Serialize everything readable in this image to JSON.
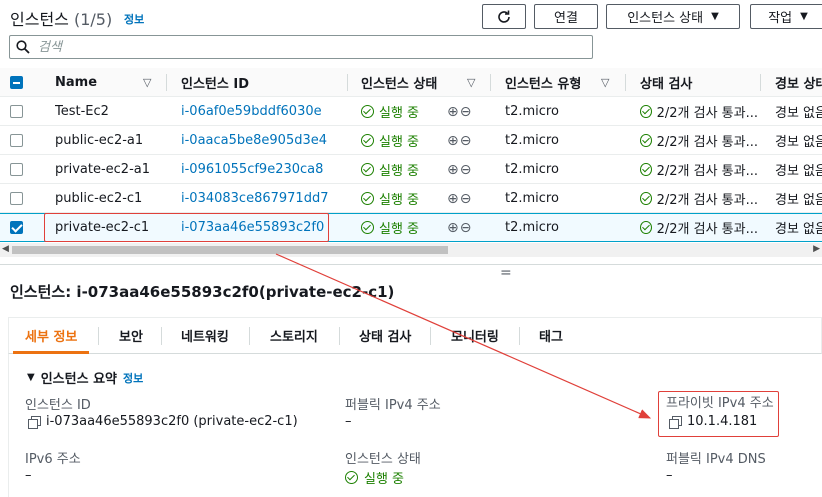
{
  "header": {
    "title": "인스턴스",
    "count": "(1/5)",
    "info": "정보",
    "refresh_icon": "refresh-icon",
    "connect_label": "연결",
    "state_label": "인스턴스 상태",
    "actions_label": "작업"
  },
  "search": {
    "placeholder": "검색"
  },
  "table": {
    "columns": [
      "Name",
      "인스턴스 ID",
      "인스턴스 상태",
      "인스턴스 유형",
      "상태 검사",
      "경보 상태"
    ],
    "rows": [
      {
        "name": "Test-Ec2",
        "id": "i-06af0e59bddf6030e",
        "state": "실행 중",
        "type": "t2.micro",
        "check": "2/2개 검사 통과...",
        "alarm": "경보 없음",
        "selected": false
      },
      {
        "name": "public-ec2-a1",
        "id": "i-0aaca5be8e905d3e4",
        "state": "실행 중",
        "type": "t2.micro",
        "check": "2/2개 검사 통과...",
        "alarm": "경보 없음",
        "selected": false
      },
      {
        "name": "private-ec2-a1",
        "id": "i-0961055cf9e230ca8",
        "state": "실행 중",
        "type": "t2.micro",
        "check": "2/2개 검사 통과...",
        "alarm": "경보 없음",
        "selected": false
      },
      {
        "name": "public-ec2-c1",
        "id": "i-034083ce867971dd7",
        "state": "실행 중",
        "type": "t2.micro",
        "check": "2/2개 검사 통과...",
        "alarm": "경보 없음",
        "selected": false
      },
      {
        "name": "private-ec2-c1",
        "id": "i-073aa46e55893c2f0",
        "state": "실행 중",
        "type": "t2.micro",
        "check": "2/2개 검사 통과...",
        "alarm": "경보 없음",
        "selected": true
      }
    ]
  },
  "detail": {
    "title": "인스턴스: i-073aa46e55893c2f0(private-ec2-c1)",
    "tabs": [
      "세부 정보",
      "보안",
      "네트워킹",
      "스토리지",
      "상태 검사",
      "모니터링",
      "태그"
    ],
    "summary_label": "인스턴스 요약",
    "summary_info": "정보",
    "fields": {
      "instance_id_label": "인스턴스 ID",
      "instance_id_value": "i-073aa46e55893c2f0 (private-ec2-c1)",
      "public_ipv4_label": "퍼블릭 IPv4 주소",
      "public_ipv4_value": "–",
      "private_ipv4_label": "프라이빗 IPv4 주소",
      "private_ipv4_value": "10.1.4.181",
      "ipv6_label": "IPv6 주소",
      "ipv6_value": "–",
      "instance_state_label": "인스턴스 상태",
      "instance_state_value": "실행 중",
      "public_dns_label": "퍼블릭 IPv4 DNS",
      "public_dns_value": "–"
    }
  },
  "colors": {
    "link": "#0073bb",
    "ok": "#1d8102",
    "accent": "#ec7211",
    "annotation": "#e0403a"
  }
}
